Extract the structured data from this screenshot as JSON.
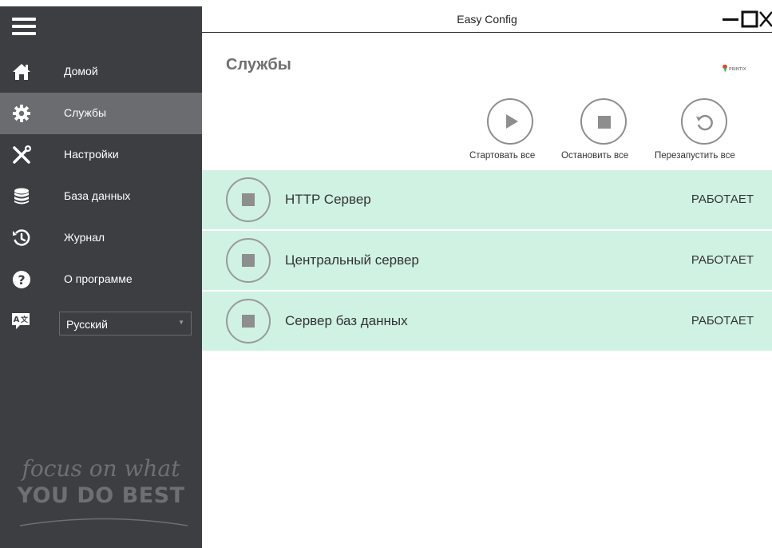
{
  "window": {
    "title": "Easy Config"
  },
  "sidebar": {
    "menu_icon": "hamburger-icon",
    "items": [
      {
        "label": "Домой",
        "icon": "home-icon"
      },
      {
        "label": "Службы",
        "icon": "gear-icon",
        "active": true
      },
      {
        "label": "Настройки",
        "icon": "tools-icon"
      },
      {
        "label": "База данных",
        "icon": "database-icon"
      },
      {
        "label": "Журнал",
        "icon": "history-icon"
      },
      {
        "label": "О программе",
        "icon": "help-icon"
      }
    ],
    "language": {
      "icon": "language-icon",
      "value": "Русский"
    },
    "slogan_line1": "focus on what",
    "slogan_line2": "YOU DO BEST"
  },
  "main": {
    "page_title": "Службы",
    "brand_logo": "PRINTIX",
    "actions": [
      {
        "label": "Стартовать все",
        "icon": "play-icon"
      },
      {
        "label": "Остановить все",
        "icon": "stop-icon"
      },
      {
        "label": "Перезапустить все",
        "icon": "restart-icon"
      }
    ],
    "services": [
      {
        "name": "HTTP Сервер",
        "status": "РАБОТАЕТ"
      },
      {
        "name": "Центральный сервер",
        "status": "РАБОТАЕТ"
      },
      {
        "name": "Сервер баз данных",
        "status": "РАБОТАЕТ"
      }
    ]
  },
  "colors": {
    "sidebar_bg": "#3d3e42",
    "sidebar_active": "#6b6c70",
    "service_running_bg": "#cff2e3",
    "icon_gray": "#8e8e8e"
  }
}
